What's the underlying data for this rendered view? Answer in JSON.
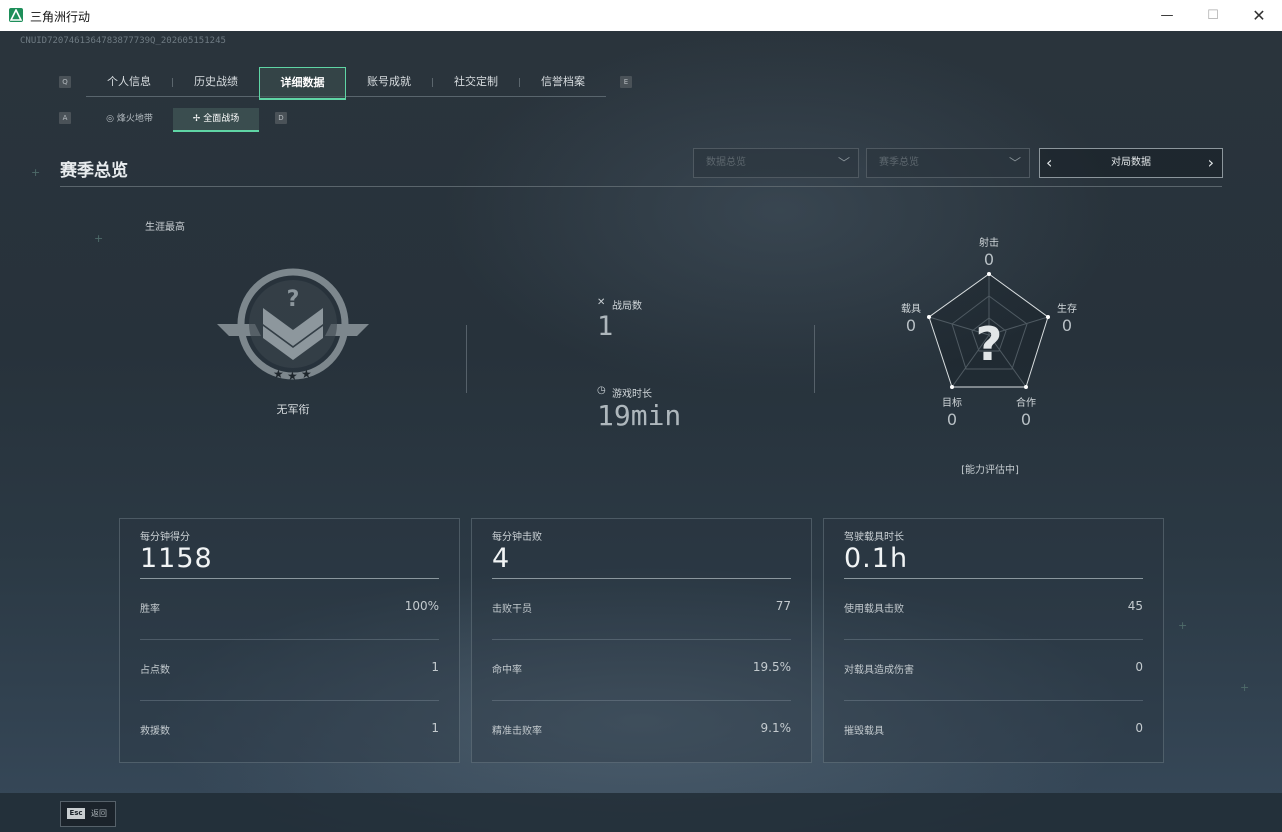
{
  "window": {
    "title": "三角洲行动",
    "minimize": "—",
    "maximize": "☐",
    "close": "✕"
  },
  "uid": "CNUID7207461364783877739Q_202605151245",
  "tabs": {
    "prev_key": "Q",
    "next_key": "E",
    "items": [
      {
        "label": "个人信息"
      },
      {
        "label": "历史战绩"
      },
      {
        "label": "详细数据",
        "active": true
      },
      {
        "label": "账号成就"
      },
      {
        "label": "社交定制"
      },
      {
        "label": "信誉档案"
      }
    ]
  },
  "subtabs": {
    "prev_key": "A",
    "next_key": "D",
    "items": [
      {
        "label": "烽火地带",
        "icon": "zone-icon"
      },
      {
        "label": "全面战场",
        "icon": "battlefield-icon",
        "active": true
      }
    ]
  },
  "header": {
    "title": "赛季总览",
    "dropdown1": "数据总览",
    "dropdown2": "赛季总览",
    "pager_label": "对局数据"
  },
  "rank": {
    "career_label": "生涯最高",
    "name": "无军衔"
  },
  "center_stats": {
    "matches_label": "战局数",
    "matches_value": "1",
    "playtime_label": "游戏时长",
    "playtime_value": "19min"
  },
  "radar": {
    "note": "[能力评估中]",
    "axes": [
      {
        "label": "射击",
        "value": "0"
      },
      {
        "label": "生存",
        "value": "0"
      },
      {
        "label": "合作",
        "value": "0"
      },
      {
        "label": "目标",
        "value": "0"
      },
      {
        "label": "载具",
        "value": "0"
      }
    ]
  },
  "cards": [
    {
      "label": "每分钟得分",
      "value": "1158",
      "rows": [
        {
          "label": "胜率",
          "value": "100%"
        },
        {
          "label": "占点数",
          "value": "1"
        },
        {
          "label": "救援数",
          "value": "1"
        }
      ]
    },
    {
      "label": "每分钟击败",
      "value": "4",
      "rows": [
        {
          "label": "击败干员",
          "value": "77"
        },
        {
          "label": "命中率",
          "value": "19.5%"
        },
        {
          "label": "精准击败率",
          "value": "9.1%"
        }
      ]
    },
    {
      "label": "驾驶载具时长",
      "value": "0.1h",
      "rows": [
        {
          "label": "使用载具击败",
          "value": "45"
        },
        {
          "label": "对载具造成伤害",
          "value": "0"
        },
        {
          "label": "摧毁载具",
          "value": "0"
        }
      ]
    }
  ],
  "bottom": {
    "esc_key": "Esc",
    "esc_label": "返回"
  }
}
